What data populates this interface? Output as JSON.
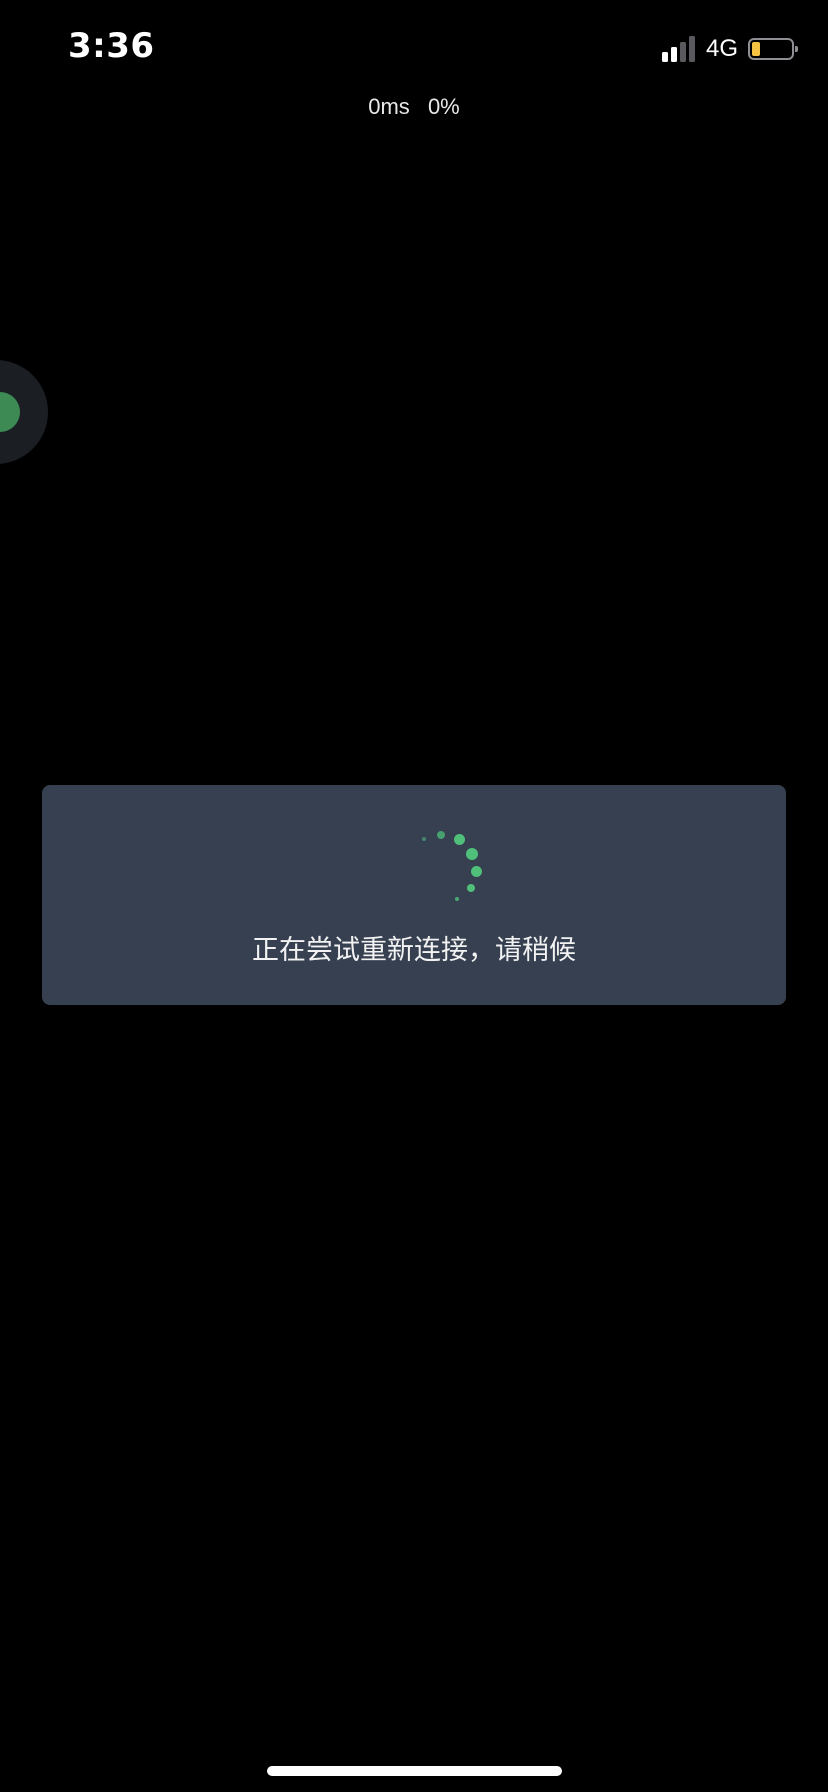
{
  "status_bar": {
    "time": "3:36",
    "network": "4G",
    "battery_level": 0.2
  },
  "stats": {
    "latency": "0ms",
    "loss": "0%"
  },
  "dialog": {
    "message": "正在尝试重新连接，请稍候"
  },
  "colors": {
    "background": "#000000",
    "dialog_bg": "#364050",
    "accent_green": "#4fbf7a",
    "battery_fill": "#f6c343"
  },
  "icons": {
    "signal": "signal-bars-icon",
    "battery": "battery-icon",
    "spinner": "loading-spinner-icon",
    "handle": "floating-handle-icon"
  }
}
